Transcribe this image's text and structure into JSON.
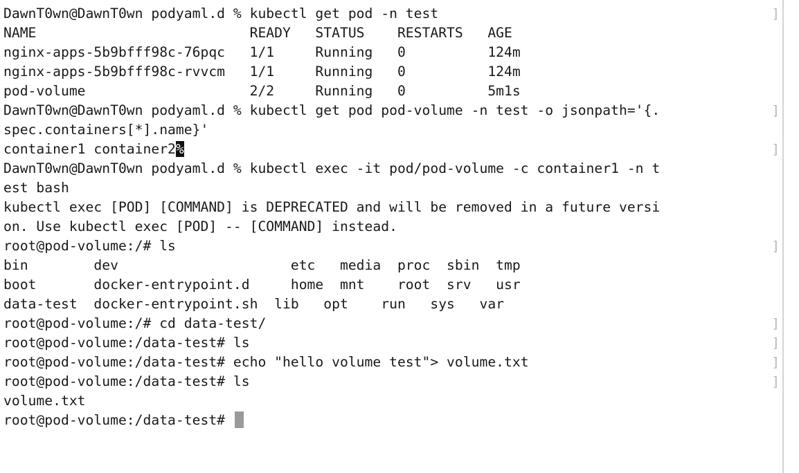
{
  "terminal": {
    "lines": [
      {
        "text": "DawnT0wn@DawnT0wn podyaml.d % kubectl get pod -n test",
        "mark": "]"
      },
      {
        "text": "NAME                          READY   STATUS    RESTARTS   AGE"
      },
      {
        "text": "nginx-apps-5b9bfff98c-76pqc   1/1     Running   0          124m"
      },
      {
        "text": "nginx-apps-5b9bfff98c-rvvcm   1/1     Running   0          124m"
      },
      {
        "text": "pod-volume                    2/2     Running   0          5m1s"
      },
      {
        "text": "DawnT0wn@DawnT0wn podyaml.d % kubectl get pod pod-volume -n test -o jsonpath='{.",
        "mark": "]"
      },
      {
        "text": "spec.containers[*].name}'"
      },
      {
        "text": "container1 container2",
        "inverse": "%",
        "mark": "]"
      },
      {
        "text": "DawnT0wn@DawnT0wn podyaml.d % kubectl exec -it pod/pod-volume -c container1 -n t"
      },
      {
        "text": "est bash"
      },
      {
        "text": "kubectl exec [POD] [COMMAND] is DEPRECATED and will be removed in a future versi"
      },
      {
        "text": "on. Use kubectl exec [POD] -- [COMMAND] instead."
      },
      {
        "text": "root@pod-volume:/# ls",
        "mark": "]"
      },
      {
        "text": "bin        dev                     etc   media  proc  sbin  tmp"
      },
      {
        "text": "boot       docker-entrypoint.d     home  mnt    root  srv   usr"
      },
      {
        "text": "data-test  docker-entrypoint.sh  lib   opt    run   sys   var"
      },
      {
        "text": "root@pod-volume:/# cd data-test/",
        "mark": "]"
      },
      {
        "text": "root@pod-volume:/data-test# ls",
        "mark": "]"
      },
      {
        "text": "root@pod-volume:/data-test# echo \"hello volume test\"> volume.txt",
        "mark": "]"
      },
      {
        "text": "root@pod-volume:/data-test# ls",
        "mark": "]"
      },
      {
        "text": "volume.txt"
      },
      {
        "text": "root@pod-volume:/data-test# ",
        "cursor": true
      }
    ]
  }
}
